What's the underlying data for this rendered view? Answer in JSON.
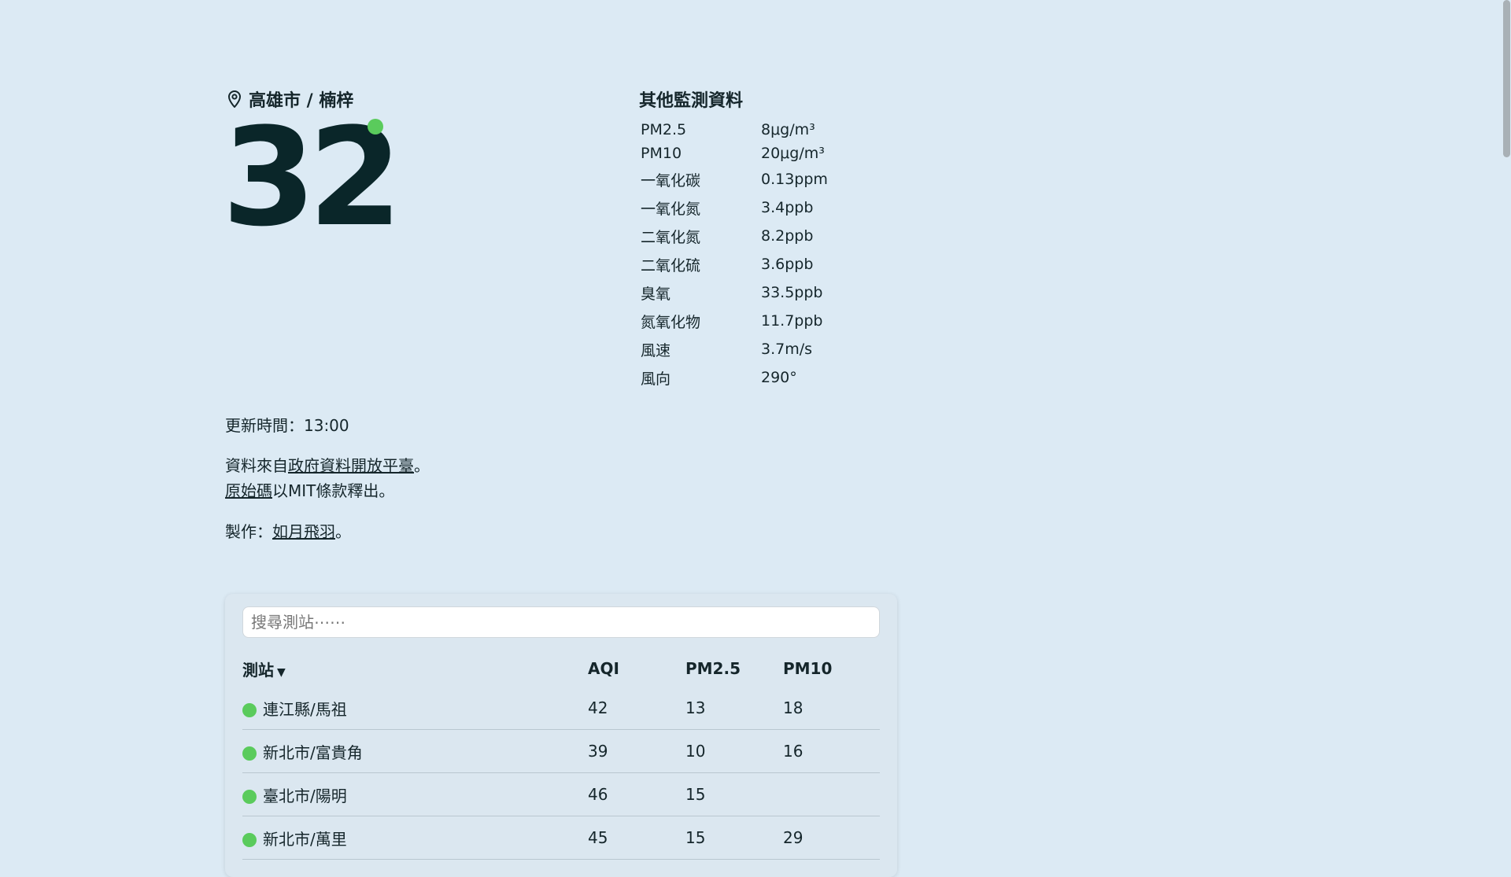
{
  "location": {
    "icon": "map-pin-icon",
    "label": "高雄市 / 楠梓"
  },
  "aqi": {
    "value": "32",
    "status_color": "#5acb5c"
  },
  "other_data": {
    "title": "其他監測資料",
    "metrics": [
      {
        "label": "PM2.5",
        "value": "8μg/m³"
      },
      {
        "label": "PM10",
        "value": "20μg/m³"
      },
      {
        "label": "一氧化碳",
        "value": "0.13ppm"
      },
      {
        "label": "一氧化氮",
        "value": "3.4ppb"
      },
      {
        "label": "二氧化氮",
        "value": "8.2ppb"
      },
      {
        "label": "二氧化硫",
        "value": "3.6ppb"
      },
      {
        "label": "臭氧",
        "value": "33.5ppb"
      },
      {
        "label": "氮氧化物",
        "value": "11.7ppb"
      },
      {
        "label": "風速",
        "value": "3.7m/s"
      },
      {
        "label": "風向",
        "value": "290°"
      }
    ]
  },
  "updated": "更新時間：13:00",
  "source": {
    "prefix": "資料來自",
    "link_text": "政府資料開放平臺",
    "suffix": "。",
    "code_link_text": "原始碼",
    "code_suffix": "以MIT條款釋出。"
  },
  "author": {
    "prefix": "製作：",
    "link_text": "如月飛羽",
    "suffix": "。"
  },
  "search": {
    "placeholder": "搜尋測站⋯⋯"
  },
  "table": {
    "headers": {
      "station": "測站",
      "sort_icon": "caret-down-icon",
      "aqi": "AQI",
      "pm25": "PM2.5",
      "pm10": "PM10"
    },
    "rows": [
      {
        "name": "連江縣/馬祖",
        "aqi": "42",
        "pm25": "13",
        "pm10": "18",
        "status_color": "#5acb5c"
      },
      {
        "name": "新北市/富貴角",
        "aqi": "39",
        "pm25": "10",
        "pm10": "16",
        "status_color": "#5acb5c"
      },
      {
        "name": "臺北市/陽明",
        "aqi": "46",
        "pm25": "15",
        "pm10": "",
        "status_color": "#5acb5c"
      },
      {
        "name": "新北市/萬里",
        "aqi": "45",
        "pm25": "15",
        "pm10": "29",
        "status_color": "#5acb5c"
      }
    ]
  }
}
